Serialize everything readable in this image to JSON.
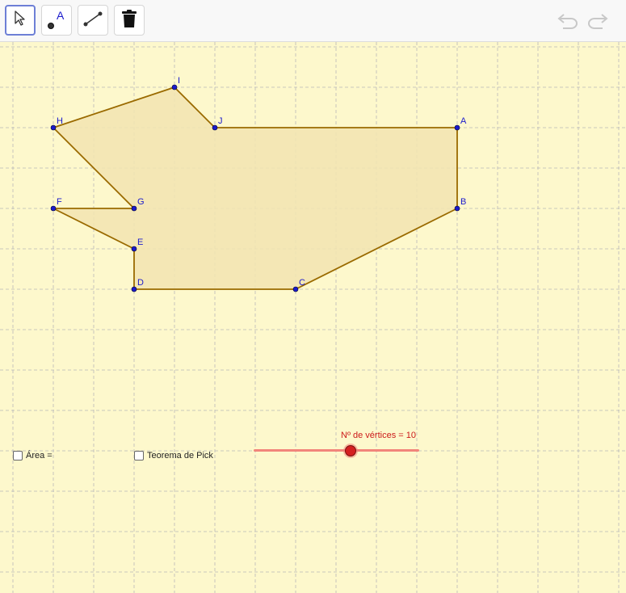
{
  "toolbar": {
    "tools": [
      {
        "name": "move-tool",
        "icon": "cursor-arrow-icon",
        "active": true
      },
      {
        "name": "point-tool",
        "icon": "point-A-icon",
        "glyph": "A",
        "active": false
      },
      {
        "name": "segment-tool",
        "icon": "segment-icon",
        "active": false
      },
      {
        "name": "delete-tool",
        "icon": "trash-icon",
        "active": false
      }
    ],
    "undo_icon": "undo-icon",
    "redo_icon": "redo-icon"
  },
  "colors": {
    "grid_bg": "#fdf8cc",
    "grid_line": "#b8b8b8",
    "polygon_fill": "#f2e4b0",
    "polygon_stroke": "#9a6a00",
    "vertex": "#1a1acc",
    "label": "#1a1acc",
    "slider_track": "#f2857b",
    "slider_text": "#cc1a1a"
  },
  "graph": {
    "vertices": [
      {
        "label": "A",
        "x": 10,
        "y": 4
      },
      {
        "label": "B",
        "x": 10,
        "y": 2
      },
      {
        "label": "C",
        "x": 6,
        "y": 0
      },
      {
        "label": "D",
        "x": 2,
        "y": 0
      },
      {
        "label": "E",
        "x": 2,
        "y": 1
      },
      {
        "label": "F",
        "x": 0,
        "y": 2
      },
      {
        "label": "G",
        "x": 2,
        "y": 2
      },
      {
        "label": "H",
        "x": 0,
        "y": 4
      },
      {
        "label": "I",
        "x": 3,
        "y": 5
      },
      {
        "label": "J",
        "x": 4,
        "y": 4
      }
    ]
  },
  "controls": {
    "area_checkbox": {
      "label": "Área =",
      "checked": false
    },
    "pick_checkbox": {
      "label": "Teorema de Pick",
      "checked": false
    },
    "slider": {
      "label": "Nº de vértices = 10",
      "value": 10,
      "min": 3,
      "max": 15
    }
  }
}
